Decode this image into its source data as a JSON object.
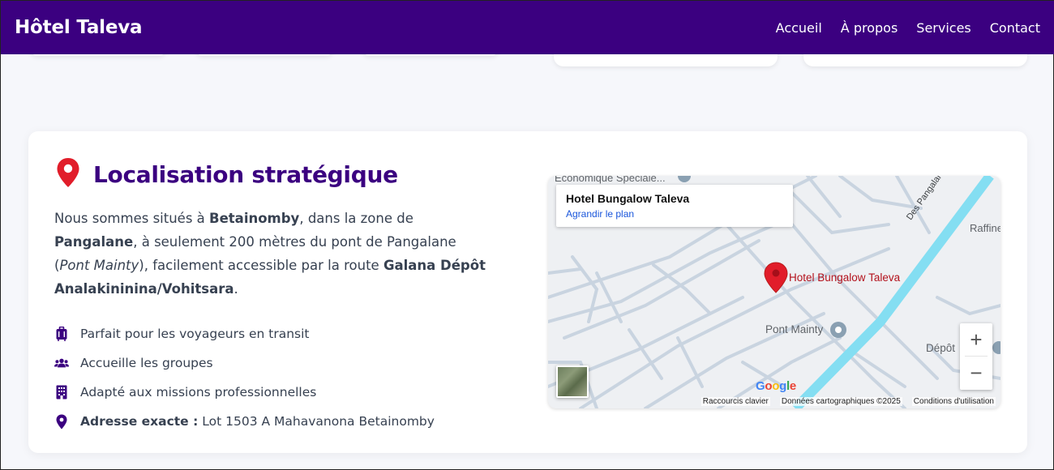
{
  "nav": {
    "brand": "Hôtel Taleva",
    "links": [
      "Accueil",
      "À propos",
      "Services",
      "Contact"
    ]
  },
  "location": {
    "title": "Localisation stratégique",
    "desc": {
      "p1": "Nous sommes situés à ",
      "b1": "Betainomby",
      "p2": ", dans la zone de ",
      "b2": "Pangalane",
      "p3": ", à seulement 200 mètres du pont de Pangalane (",
      "i1": "Pont Mainty",
      "p4": "), facilement accessible par la route ",
      "b3": "Galana Dépôt Analakininina/Vohitsara",
      "p5": "."
    },
    "features": [
      {
        "icon": "suitcase-icon",
        "text": "Parfait pour les voyageurs en transit"
      },
      {
        "icon": "users-icon",
        "text": "Accueille les groupes"
      },
      {
        "icon": "building-icon",
        "text": "Adapté aux missions professionnelles"
      }
    ],
    "address": {
      "icon": "map-pin-icon",
      "label": "Adresse exacte :",
      "value": "Lot 1503 A Mahavanona Betainomby"
    }
  },
  "map": {
    "info_title": "Hotel Bungalow Taleva",
    "info_link": "Agrandir le plan",
    "marker_label": "Hotel Bungalow Taleva",
    "labels": {
      "top_cut": "Économique Spéciale...",
      "road": "Des Pangalanes",
      "raffin": "Raffine",
      "pont": "Pont Mainty",
      "depot": "Dépôt"
    },
    "zoom_in": "+",
    "zoom_out": "−",
    "google": "Google",
    "attribution": [
      "Raccourcis clavier",
      "Données cartographiques ©2025",
      "Conditions d'utilisation"
    ]
  },
  "colors": {
    "brand": "#3b0080",
    "marker": "#e11d2a",
    "main_road": "#7fdcf0"
  }
}
